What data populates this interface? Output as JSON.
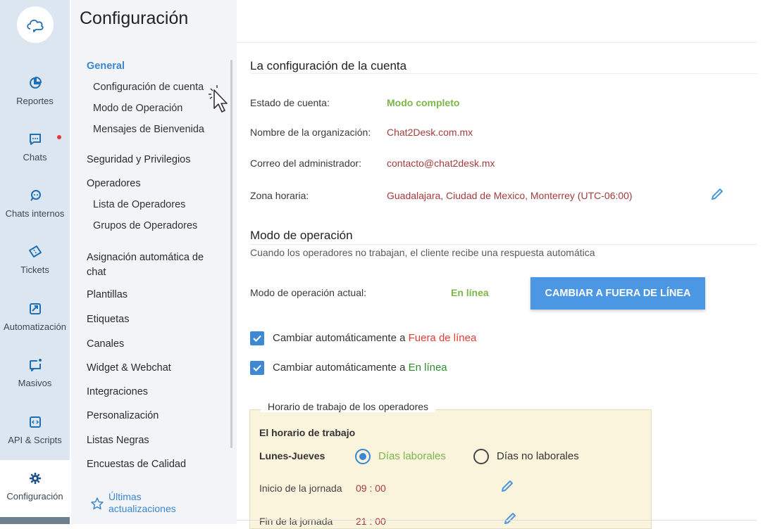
{
  "rail": {
    "items": [
      {
        "label": "Reportes",
        "icon": "pie-chart-icon"
      },
      {
        "label": "Chats",
        "icon": "chat-icon"
      },
      {
        "label": "Chats internos",
        "icon": "internal-chat-icon"
      },
      {
        "label": "Tickets",
        "icon": "ticket-icon"
      },
      {
        "label": "Automatización",
        "icon": "automation-icon"
      },
      {
        "label": "Masivos",
        "icon": "broadcast-icon"
      },
      {
        "label": "API & Scripts",
        "icon": "code-icon"
      },
      {
        "label": "Configuración",
        "icon": "gear-icon"
      }
    ]
  },
  "sidebar": {
    "title": "Configuración",
    "general": "General",
    "general_items": [
      "Configuración de cuenta",
      "Modo de Operación",
      "Mensajes de Bienvenida"
    ],
    "security": "Seguridad y Privilegios",
    "operators": "Operadores",
    "operator_items": [
      "Lista de Operadores",
      "Grupos de Operadores"
    ],
    "auto_assign": "Asignación automática de chat",
    "templates": "Plantillas",
    "tags": "Etiquetas",
    "channels": "Canales",
    "widget": "Widget & Webchat",
    "integrations": "Integraciones",
    "personalization": "Personalización",
    "blacklists": "Listas Negras",
    "surveys": "Encuestas de Calidad",
    "updates": "Últimas actualizaciones"
  },
  "account": {
    "heading": "La configuración de la cuenta",
    "status_label": "Estado de cuenta:",
    "status_value": "Modo completo",
    "org_label": "Nombre de la organización:",
    "org_value": "Chat2Desk.com.mx",
    "email_label": "Correo del administrador:",
    "email_value": "contacto@chat2desk.mx",
    "tz_label": "Zona horaria:",
    "tz_value": "Guadalajara, Ciudad de Mexico, Monterrey (UTC-06:00)"
  },
  "mode": {
    "heading": "Modo de operación",
    "description": "Cuando los operadores no trabajan, el cliente recibe una respuesta automática",
    "current_label": "Modo de operación actual:",
    "current_value": "En línea",
    "button": "CAMBIAR A FUERA DE LÍNEA",
    "cb1_prefix": "Cambiar automáticamente a ",
    "cb1_highlight": "Fuera de línea",
    "cb2_prefix": "Cambiar automáticamente a ",
    "cb2_highlight": "En línea"
  },
  "schedule": {
    "legend": "Horario de trabajo de los operadores",
    "title": "El horario de trabajo",
    "days": "Lunes-Jueves",
    "opt_work": "Días laborales",
    "opt_nowork": "Días no laborales",
    "start_label": "Inicio de la jornada",
    "start_value": "09 : 00",
    "end_label": "Fin de la jornada",
    "end_value": "21 : 00"
  }
}
